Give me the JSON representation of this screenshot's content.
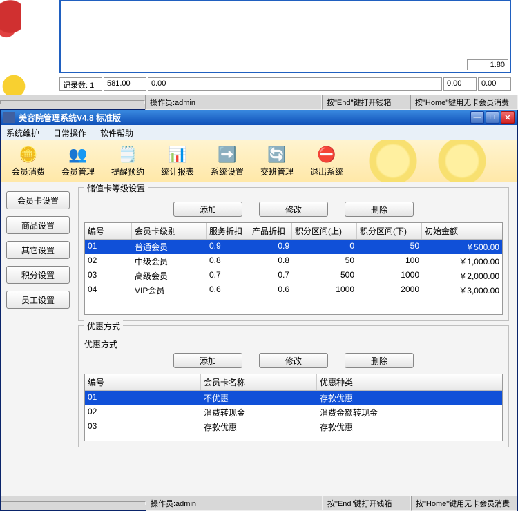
{
  "top": {
    "bottom_right_value": "1.80",
    "status": {
      "records_label": "记录数: 1",
      "col2": "581.00",
      "col3": "0.00",
      "col4": "0.00",
      "col5": "0.00"
    },
    "footer": {
      "operator": "操作员:admin",
      "hint_end": "按\"End\"键打开钱箱",
      "hint_home": "按\"Home\"键用无卡会员消费"
    }
  },
  "window": {
    "title": "美容院管理系统V4.8 标准版"
  },
  "menu": {
    "sys": "系统维护",
    "daily": "日常操作",
    "help": "软件帮助"
  },
  "toolbar": {
    "member_consume": "会员消费",
    "member_manage": "会员管理",
    "remind": "提醒预约",
    "reports": "统计报表",
    "sys_settings": "系统设置",
    "shift": "交班管理",
    "exit": "退出系统"
  },
  "sidebar": {
    "card": "会员卡设置",
    "product": "商品设置",
    "other": "其它设置",
    "points": "积分设置",
    "staff": "员工设置"
  },
  "group1": {
    "title": "储值卡等级设置",
    "btn_add": "添加",
    "btn_edit": "修改",
    "btn_del": "删除",
    "headers": {
      "no": "编号",
      "level": "会员卡级别",
      "svc": "服务折扣",
      "prod": "产品折扣",
      "pt_up": "积分区间(上)",
      "pt_down": "积分区间(下)",
      "init": "初始金额"
    },
    "rows": [
      {
        "no": "01",
        "level": "普通会员",
        "svc": "0.9",
        "prod": "0.9",
        "pt_up": "0",
        "pt_down": "50",
        "init": "￥500.00"
      },
      {
        "no": "02",
        "level": "中级会员",
        "svc": "0.8",
        "prod": "0.8",
        "pt_up": "50",
        "pt_down": "100",
        "init": "￥1,000.00"
      },
      {
        "no": "03",
        "level": "高级会员",
        "svc": "0.7",
        "prod": "0.7",
        "pt_up": "500",
        "pt_down": "1000",
        "init": "￥2,000.00"
      },
      {
        "no": "04",
        "level": "VIP会员",
        "svc": "0.6",
        "prod": "0.6",
        "pt_up": "1000",
        "pt_down": "2000",
        "init": "￥3,000.00"
      }
    ]
  },
  "group2": {
    "title": "优惠方式",
    "sub": "优惠方式",
    "btn_add": "添加",
    "btn_edit": "修改",
    "btn_del": "删除",
    "headers": {
      "no": "编号",
      "name": "会员卡名称",
      "type": "优惠种类"
    },
    "rows": [
      {
        "no": "01",
        "name": "不优惠",
        "type": "存款优惠"
      },
      {
        "no": "02",
        "name": "消费转现金",
        "type": "消费金额转现金"
      },
      {
        "no": "03",
        "name": "存款优惠",
        "type": "存款优惠"
      }
    ]
  },
  "footer": {
    "operator": "操作员:admin",
    "hint_end": "按\"End\"键打开钱箱",
    "hint_home": "按\"Home\"键用无卡会员消费"
  }
}
